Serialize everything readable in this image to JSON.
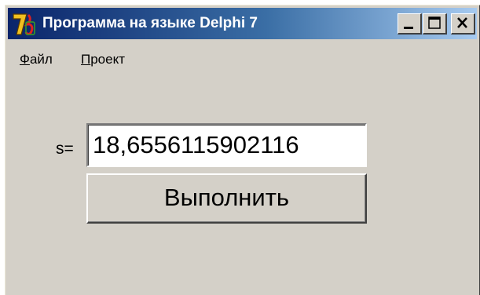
{
  "window": {
    "title": "Программа на языке Delphi 7",
    "app_icon": "delphi-7-icon",
    "caption_buttons": {
      "minimize": "minimize-icon",
      "maximize": "maximize-icon",
      "close": "close-icon"
    }
  },
  "menu": {
    "file": {
      "mnemonic": "Ф",
      "rest": "айл"
    },
    "project": {
      "mnemonic": "П",
      "rest": "роект"
    }
  },
  "form": {
    "s_label": "s=",
    "s_value": "18,6556115902116",
    "run_button_label": "Выполнить"
  },
  "colors": {
    "face": "#d4d0c8",
    "title_start": "#0a246a",
    "title_end": "#a6caf0"
  }
}
